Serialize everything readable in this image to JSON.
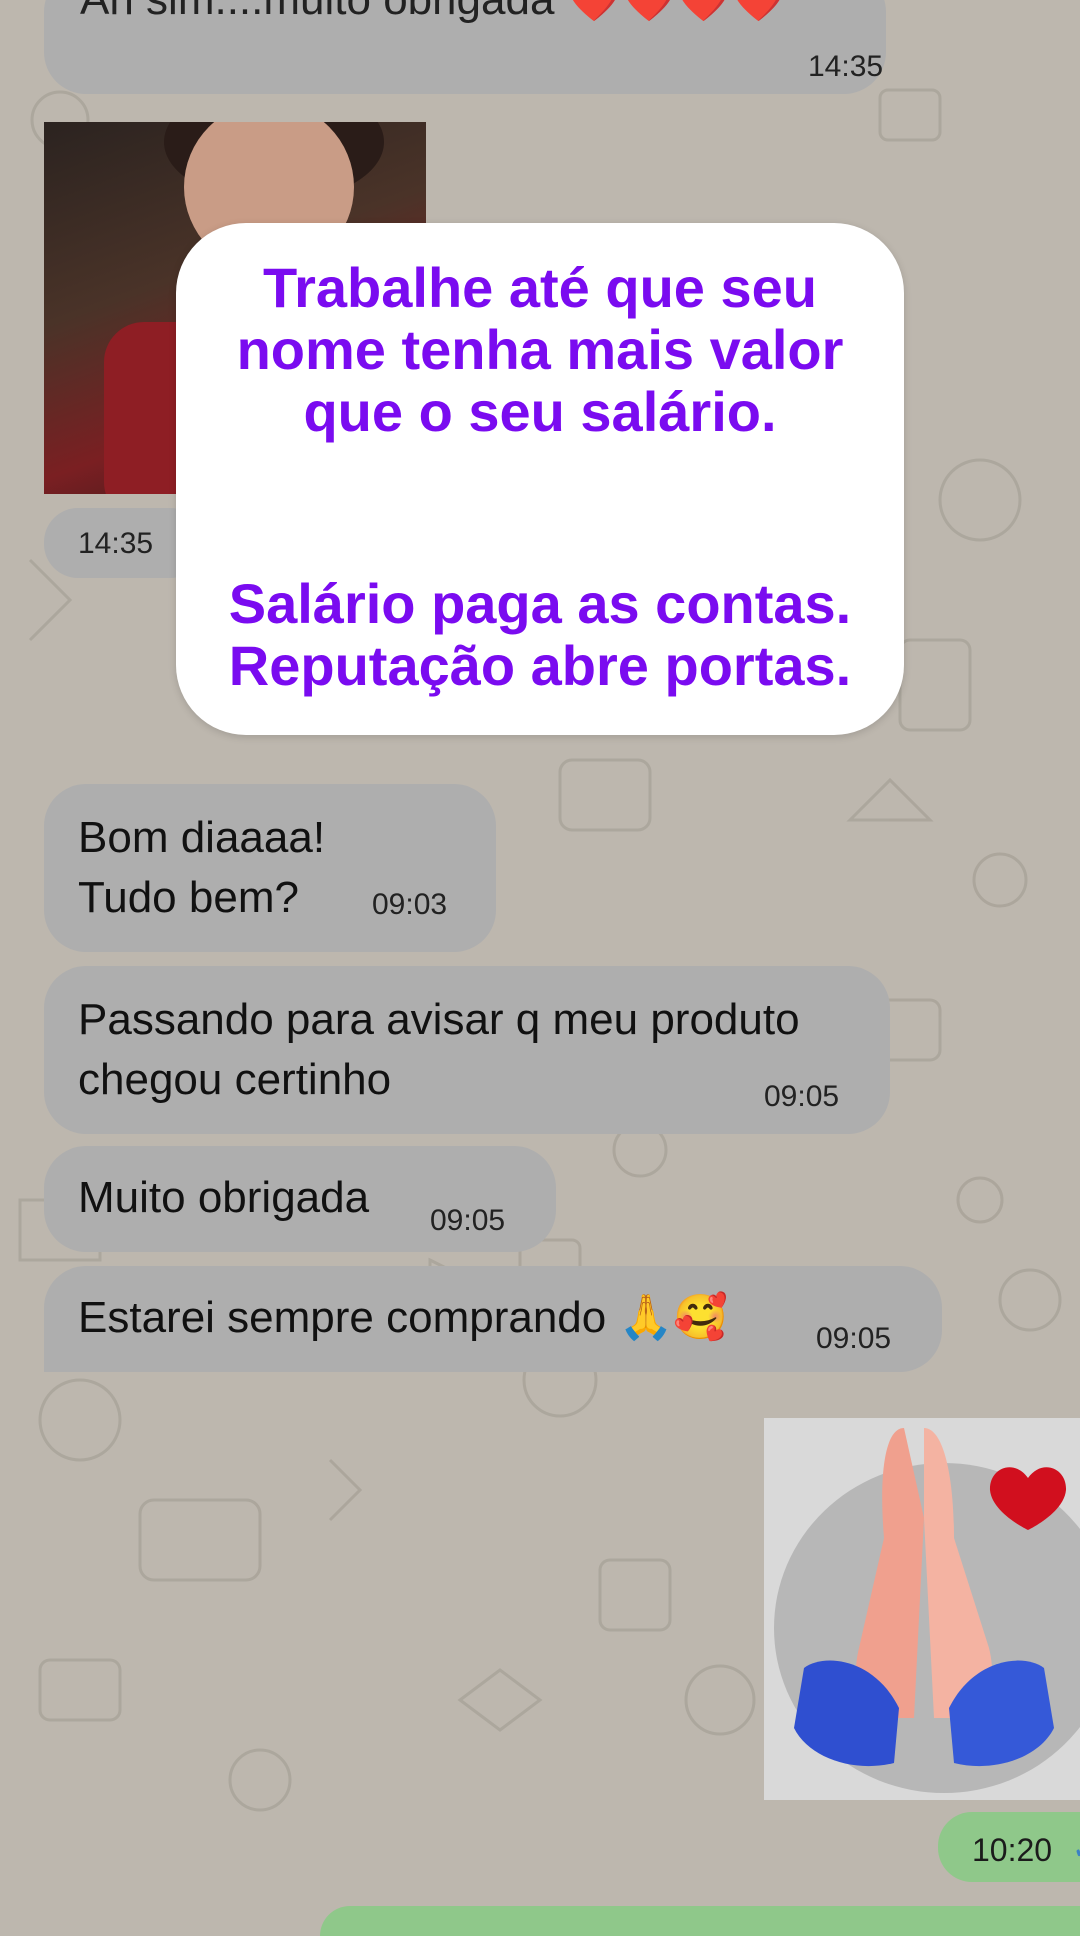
{
  "chat": {
    "top_message": {
      "text": "Ah sim....muito obrigada ❤️❤️❤️❤️",
      "time": "14:35"
    },
    "photo_message": {
      "time": "14:35"
    },
    "overlay": {
      "line1": "Trabalhe até que seu",
      "line2": "nome tenha mais valor",
      "line3": "que o seu salário.",
      "line4": "Salário paga as contas.",
      "line5": "Reputação abre portas."
    },
    "messages": [
      {
        "line1": "Bom diaaaa!",
        "line2": "Tudo bem?",
        "time": "09:03"
      },
      {
        "line1": "Passando para avisar q meu produto",
        "line2": "chegou certinho",
        "time": "09:05"
      },
      {
        "text": "Muito obrigada",
        "time": "09:05"
      },
      {
        "text": "Estarei sempre comprando 🙏🥰",
        "time": "09:05"
      }
    ],
    "outgoing": {
      "time": "10:20",
      "status_icon": "double-check-icon"
    }
  },
  "colors": {
    "overlay_text": "#7a0bf0",
    "incoming_bubble": "#aeaeae",
    "outgoing_bubble": "#8fc88a",
    "wallpaper": "#bdb7ae"
  }
}
